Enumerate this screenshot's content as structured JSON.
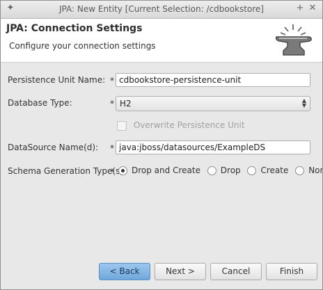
{
  "window": {
    "title": "JPA: New Entity [Current Selection: /cdbookstore]"
  },
  "header": {
    "title": "JPA: Connection Settings",
    "subtitle": "Configure your connection settings"
  },
  "form": {
    "persistence_unit_label": "Persistence Unit Name:",
    "persistence_unit_value": "cdbookstore-persistence-unit",
    "database_type_label": "Database Type:",
    "database_type_value": "H2",
    "overwrite_label": "Overwrite Persistence Unit",
    "overwrite_checked": false,
    "datasource_label": "DataSource Name(d):",
    "datasource_value": "java:jboss/datasources/ExampleDS",
    "schema_label": "Schema Generation Type(s):",
    "schema_options": [
      "Drop and Create",
      "Drop",
      "Create",
      "None"
    ],
    "schema_selected": "Drop and Create",
    "required_marker": "*"
  },
  "buttons": {
    "back": "< Back",
    "next": "Next >",
    "cancel": "Cancel",
    "finish": "Finish"
  },
  "icons": {
    "title_left": "star-icon",
    "title_add": "plus-icon",
    "title_close": "close-icon",
    "banner": "anvil-icon"
  }
}
